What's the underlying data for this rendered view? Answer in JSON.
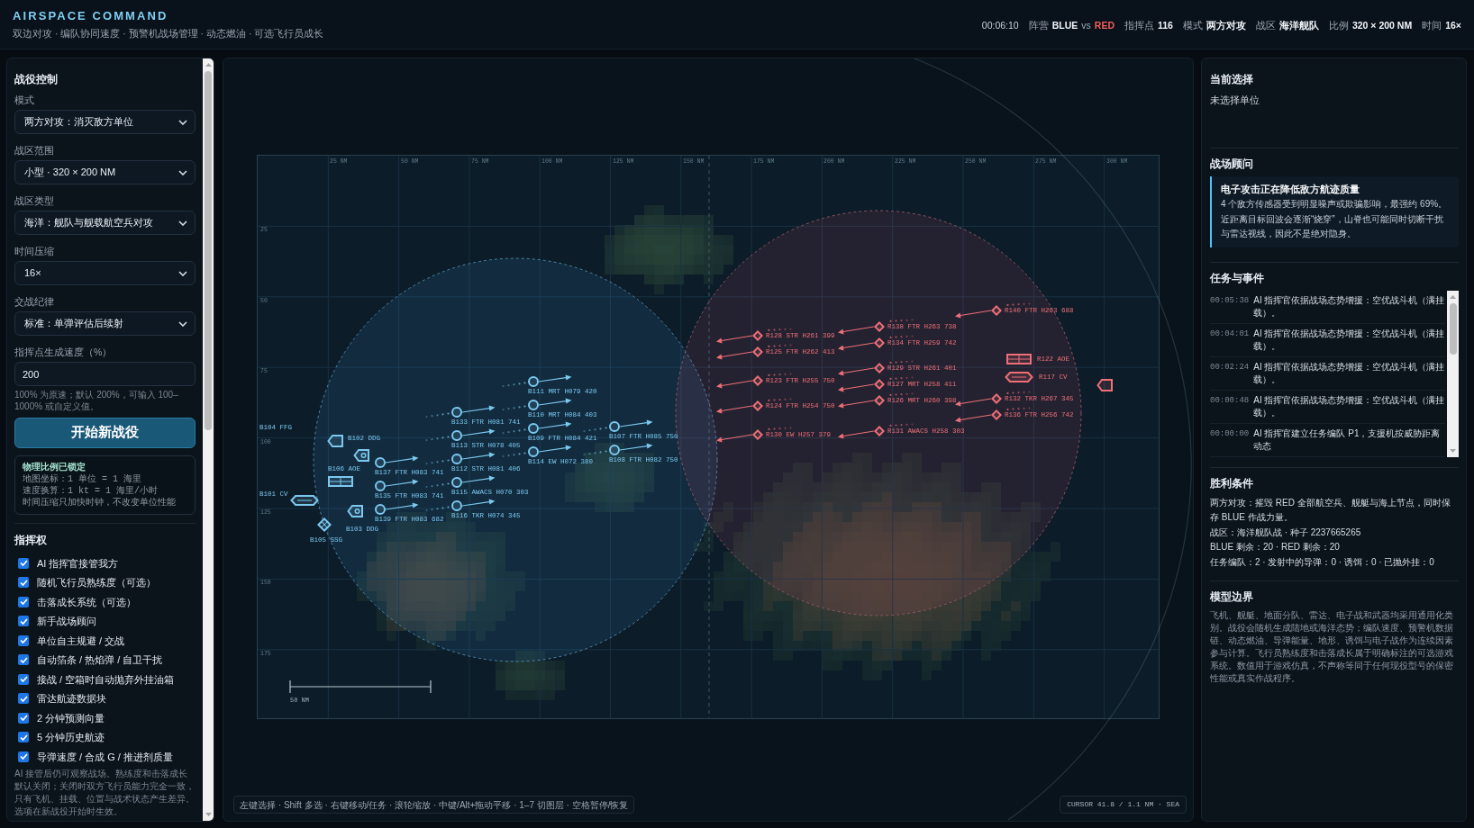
{
  "header": {
    "title": "AIRSPACE COMMAND",
    "subtitle": "双边对攻 · 编队协同速度 · 预警机战场管理 · 动态燃油 · 可选飞行员成长",
    "clock": "00:06:10",
    "stats": [
      {
        "kind": "versus",
        "label": "阵营",
        "left": "BLUE",
        "joiner": "vs",
        "right": "RED"
      },
      {
        "kind": "plain",
        "label": "指挥点",
        "value": "116"
      },
      {
        "kind": "plain",
        "label": "模式",
        "value": "两方对攻"
      },
      {
        "kind": "plain",
        "label": "战区",
        "value": "海洋舰队"
      },
      {
        "kind": "plain",
        "label": "比例",
        "value": "320 × 200 NM"
      },
      {
        "kind": "plain",
        "label": "时间",
        "value": "16×"
      }
    ]
  },
  "sidebar": {
    "title": "战役控制",
    "fields": [
      {
        "kind": "select",
        "label": "模式",
        "value": "两方对攻：消灭敌方单位"
      },
      {
        "kind": "select",
        "label": "战区范围",
        "value": "小型 · 320 × 200 NM"
      },
      {
        "kind": "select",
        "label": "战区类型",
        "value": "海洋：舰队与舰载航空兵对攻"
      },
      {
        "kind": "select",
        "label": "时间压缩",
        "value": "16×"
      },
      {
        "kind": "select",
        "label": "交战纪律",
        "value": "标准：单弹评估后续射"
      },
      {
        "kind": "input",
        "label": "指挥点生成速度（%）",
        "value": "200"
      }
    ],
    "hint": "100% 为原速；默认 200%，可输入 100–1000% 或自定义值。",
    "start_button": "开始新战役",
    "scale_note": {
      "title": "物理比例已锁定",
      "lines": [
        "地图坐标：1 单位 = 1 海里",
        "速度换算：1 kt = 1 海里/小时",
        "时间压缩只加快时钟，不改变单位性能"
      ]
    },
    "command_title": "指挥权",
    "options": [
      {
        "label": "AI 指挥官接管我方",
        "checked": true
      },
      {
        "label": "随机飞行员熟练度（可选）",
        "checked": true
      },
      {
        "label": "击落成长系统（可选）",
        "checked": true
      },
      {
        "label": "新手战场顾问",
        "checked": true
      },
      {
        "label": "单位自主规避 / 交战",
        "checked": true
      },
      {
        "label": "自动箔条 / 热焰弹 / 自卫干扰",
        "checked": true
      },
      {
        "label": "接战 / 空箱时自动抛弃外挂油箱",
        "checked": true
      },
      {
        "label": "雷达航迹数据块",
        "checked": true
      },
      {
        "label": "2 分钟预测向量",
        "checked": true
      },
      {
        "label": "5 分钟历史航迹",
        "checked": true
      },
      {
        "label": "导弹速度 / 合成 G / 推进剂质量",
        "checked": true
      }
    ],
    "footnote": "AI 接管后仍可观察战场。熟练度和击落成长默认关闭；关闭时双方飞行员能力完全一致，只有飞机、挂载、位置与战术状态产生差异。选项在新战役开始时生效。"
  },
  "map": {
    "x_ticks": [
      "25 NM",
      "50 NM",
      "75 NM",
      "100 NM",
      "125 NM",
      "150 NM",
      "175 NM",
      "200 NM",
      "225 NM",
      "250 NM",
      "275 NM",
      "300 NM"
    ],
    "y_ticks": [
      "25",
      "50",
      "75",
      "100",
      "125",
      "150",
      "175"
    ],
    "scale_label": "50 NM",
    "units": [
      {
        "label": "B102 DDG",
        "color": "#7cc9f0",
        "kind": "destroyer"
      },
      {
        "label": "B104 FFG",
        "color": "#7cc9f0",
        "kind": "frigate"
      },
      {
        "label": "B101 CV",
        "color": "#7cc9f0",
        "kind": "carrier"
      },
      {
        "label": "B106 AOE",
        "color": "#7cc9f0",
        "kind": "supply"
      },
      {
        "label": "B103 DDG",
        "color": "#7cc9f0",
        "kind": "destroyer"
      },
      {
        "label": "B105 SSG",
        "color": "#7cc9f0",
        "kind": "submarine"
      },
      {
        "label": "B111 MRT H079 420",
        "color": "#7cc9f0",
        "kind": "air"
      },
      {
        "label": "B110 MRT H084 403",
        "color": "#7cc9f0",
        "kind": "air"
      },
      {
        "label": "B133 FTR H081 741",
        "color": "#7cc9f0",
        "kind": "air"
      },
      {
        "label": "B109 FTR H084 421",
        "color": "#7cc9f0",
        "kind": "air"
      },
      {
        "label": "B107 FTR H085 750",
        "color": "#7cc9f0",
        "kind": "air"
      },
      {
        "label": "B113 STR H078 405",
        "color": "#7cc9f0",
        "kind": "air"
      },
      {
        "label": "B114 EW H072 380",
        "color": "#7cc9f0",
        "kind": "air"
      },
      {
        "label": "B108 FTR H082 750",
        "color": "#7cc9f0",
        "kind": "air"
      },
      {
        "label": "B112 STR H081 406",
        "color": "#7cc9f0",
        "kind": "air"
      },
      {
        "label": "B137 FTR H083 741",
        "color": "#7cc9f0",
        "kind": "air"
      },
      {
        "label": "B115 AWACS H070 303",
        "color": "#7cc9f0",
        "kind": "air"
      },
      {
        "label": "B135 FTR H083 741",
        "color": "#7cc9f0",
        "kind": "air"
      },
      {
        "label": "B116 TKR H074 345",
        "color": "#7cc9f0",
        "kind": "air"
      },
      {
        "label": "B139 FTR H083 682",
        "color": "#7cc9f0",
        "kind": "air"
      },
      {
        "label": "R140 FTR H263 688",
        "color": "#ee6f78",
        "kind": "bandit"
      },
      {
        "label": "R138 FTR H263 738",
        "color": "#ee6f78",
        "kind": "bandit"
      },
      {
        "label": "R128 STR H261 399",
        "color": "#ee6f78",
        "kind": "bandit"
      },
      {
        "label": "R134 FTR H259 742",
        "color": "#ee6f78",
        "kind": "bandit"
      },
      {
        "label": "R122 AOE",
        "color": "#ee6f78",
        "kind": "supply"
      },
      {
        "label": "R125 FTR H262 413",
        "color": "#ee6f78",
        "kind": "bandit"
      },
      {
        "label": "R129 STR H261 401",
        "color": "#ee6f78",
        "kind": "bandit"
      },
      {
        "label": "R117 CV",
        "color": "#ee6f78",
        "kind": "carrier"
      },
      {
        "label": "R132 TKR H267 345",
        "color": "#ee6f78",
        "kind": "bandit"
      },
      {
        "label": "R123 FTR H255 750",
        "color": "#ee6f78",
        "kind": "bandit"
      },
      {
        "label": "R127 MRT H258 411",
        "color": "#ee6f78",
        "kind": "bandit"
      },
      {
        "label": "R126 MRT H260 398",
        "color": "#ee6f78",
        "kind": "bandit"
      },
      {
        "label": "R136 FTR H256 742",
        "color": "#ee6f78",
        "kind": "bandit"
      },
      {
        "label": "R124 FTR H254 750",
        "color": "#ee6f78",
        "kind": "bandit"
      },
      {
        "label": "R131 AWACS H258 303",
        "color": "#ee6f78",
        "kind": "bandit"
      },
      {
        "label": "R130 EW H257 379",
        "color": "#ee6f78",
        "kind": "bandit"
      },
      {
        "color": "#ee6f78",
        "kind": "frigate"
      }
    ],
    "help": "左键选择 · Shift 多选 · 右键移动/任务 · 滚轮缩放 · 中键/Alt+拖动平移 · 1–7 切图层 · 空格暂停/恢复",
    "cursor": "CURSOR 41.8 / 1.1 NM · SEA"
  },
  "panel": {
    "selection": {
      "title": "当前选择",
      "value": "未选择单位"
    },
    "advisor": {
      "title": "战场顾问",
      "alert_title": "电子攻击正在降低敌方航迹质量",
      "alert_text": "4 个敌方传感器受到明显噪声或欺骗影响，最强约 69%。近距离目标回波会逐渐“烧穿”，山脊也可能同时切断干扰与雷达视线，因此不是绝对隐身。"
    },
    "events": {
      "title": "任务与事件",
      "items": [
        {
          "time": "00:05:38",
          "text": "AI 指挥官依据战场态势增援：空优战斗机（满挂载）。"
        },
        {
          "time": "00:04:01",
          "text": "AI 指挥官依据战场态势增援：空优战斗机（满挂载）。"
        },
        {
          "time": "00:02:24",
          "text": "AI 指挥官依据战场态势增援：空优战斗机（满挂载）。"
        },
        {
          "time": "00:00:48",
          "text": "AI 指挥官依据战场态势增援：空优战斗机（满挂载）。"
        },
        {
          "time": "00:00:00",
          "text": "AI 指挥官建立任务编队 P1，支援机按威胁距离动态"
        }
      ]
    },
    "victory": {
      "title": "胜利条件",
      "lines": [
        "两方对攻：摧毁 RED 全部航空兵、舰艇与海上节点，同时保存 BLUE 作战力量。",
        "战区：海洋舰队战 · 种子 2237665265",
        "BLUE 剩余：20 · RED 剩余：20",
        "任务编队：2 · 发射中的导弹：0 · 诱饵：0 · 已抛外挂：0"
      ]
    },
    "model": {
      "title": "模型边界",
      "text": "飞机、舰艇、地面分队、雷达、电子战和武器均采用通用化类别。战役会随机生成陆地或海洋态势；编队速度、预警机数据链、动态燃油、导弹能量、地形、诱饵与电子战作为连续因素参与计算。飞行员熟练度和击落成长属于明确标注的可选游戏系统。数值用于游戏仿真，不声称等同于任何现役型号的保密性能或真实作战程序。"
    }
  }
}
